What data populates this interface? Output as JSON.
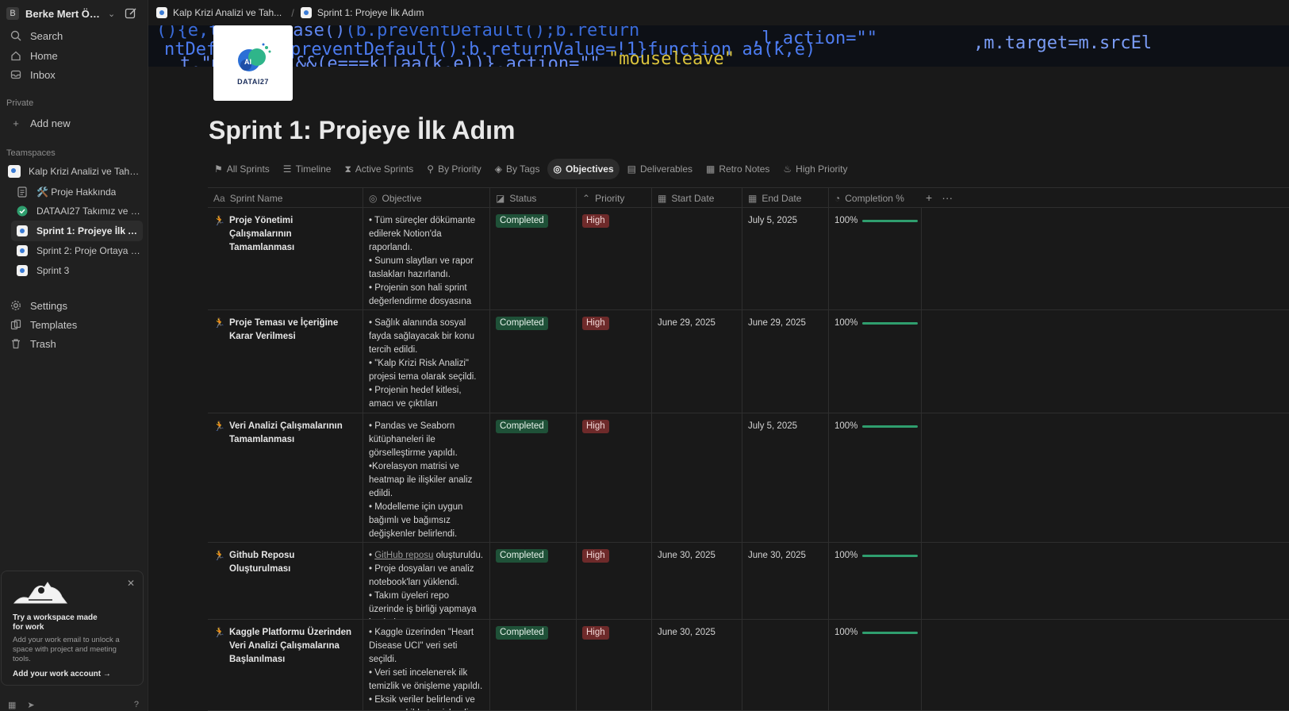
{
  "workspace": {
    "initial": "B",
    "name": "Berke Mert Öztür..."
  },
  "sidebar": {
    "top": [
      {
        "label": "Search",
        "icon": "search-icon"
      },
      {
        "label": "Home",
        "icon": "home-icon"
      },
      {
        "label": "Inbox",
        "icon": "inbox-icon"
      }
    ],
    "private_label": "Private",
    "add_new": "Add new",
    "teamspaces_label": "Teamspaces",
    "teamspace": "Kalp Krizi Analizi ve Tahmini",
    "pages": [
      {
        "label": "🛠️ Proje Hakkında",
        "icon": "document-icon"
      },
      {
        "label": "DATAAI27 Takımız ve Gör...",
        "icon": "check-circle-icon"
      },
      {
        "label": "Sprint 1: Projeye İlk Adım",
        "icon": "page-icon",
        "active": true
      },
      {
        "label": "Sprint 2: Proje Ortaya Çı...",
        "icon": "page-icon"
      },
      {
        "label": "Sprint 3",
        "icon": "page-icon"
      }
    ],
    "bottom": [
      {
        "label": "Settings",
        "icon": "gear-icon"
      },
      {
        "label": "Templates",
        "icon": "templates-icon"
      },
      {
        "label": "Trash",
        "icon": "trash-icon"
      }
    ],
    "promo": {
      "title": "Try a workspace made for work",
      "desc": "Add your work email to unlock a space with project and meeting tools.",
      "link": "Add your work account"
    }
  },
  "breadcrumb": {
    "parent": "Kalp Krizi Analizi ve Tah...",
    "current": "Sprint 1: Projeye İlk Adım"
  },
  "logo_text": "DATAI27",
  "page_title": "Sprint 1: Projeye İlk Adım",
  "tabs": [
    {
      "label": "All Sprints",
      "icon": "⚑"
    },
    {
      "label": "Timeline",
      "icon": "☰"
    },
    {
      "label": "Active Sprints",
      "icon": "⧗"
    },
    {
      "label": "By Priority",
      "icon": "⚲"
    },
    {
      "label": "By Tags",
      "icon": "◈"
    },
    {
      "label": "Objectives",
      "icon": "◎",
      "active": true
    },
    {
      "label": "Deliverables",
      "icon": "▤"
    },
    {
      "label": "Retro Notes",
      "icon": "▦"
    },
    {
      "label": "High Priority",
      "icon": "♨"
    }
  ],
  "columns": [
    {
      "label": "Sprint Name",
      "icon": "Aa"
    },
    {
      "label": "Objective",
      "icon": "◎"
    },
    {
      "label": "Status",
      "icon": "◪"
    },
    {
      "label": "Priority",
      "icon": "⌃"
    },
    {
      "label": "Start Date",
      "icon": "▦"
    },
    {
      "label": "End Date",
      "icon": "▦"
    },
    {
      "label": "Completion %",
      "icon": "◔"
    }
  ],
  "rows": [
    {
      "name": "Proje Yönetimi Çalışmalarının Tamamlanması",
      "objective": "• Tüm süreçler dökümante edilerek Notion'da raporlandı.\n• Sunum slaytları ve rapor taslakları hazırlandı.\n• Projenin son hali sprint değerlendirme dosyasına yüklendi.",
      "status": "Completed",
      "priority": "High",
      "start": "",
      "end": "July 5, 2025",
      "completion": "100%",
      "completion_value": 1.0
    },
    {
      "name": "Proje Teması ve İçeriğine Karar Verilmesi",
      "objective": "• Sağlık alanında sosyal fayda sağlayacak bir konu tercih edildi.\n• \"Kalp Krizi Risk Analizi\" projesi tema olarak seçildi.\n• Projenin hedef kitlesi, amacı ve çıktıları netleştirildi.",
      "status": "Completed",
      "priority": "High",
      "start": "June 29, 2025",
      "end": "June 29, 2025",
      "completion": "100%",
      "completion_value": 1.0
    },
    {
      "name": "Veri Analizi Çalışmalarının Tamamlanması",
      "objective": "• Pandas ve Seaborn kütüphaneleri ile görselleştirme yapıldı.\n•Korelasyon matrisi ve heatmap ile ilişkiler analiz edildi.\n• Modelleme için uygun bağımlı ve bağımsız değişkenler belirlendi.",
      "status": "Completed",
      "priority": "High",
      "start": "",
      "end": "July 5, 2025",
      "completion": "100%",
      "completion_value": 1.0
    },
    {
      "name": "Github Reposu Oluşturulması",
      "objective_link": "GitHub reposu",
      "objective": "• {link} oluşturuldu.\n• Proje dosyaları ve analiz notebook'ları yüklendi.\n• Takım üyeleri repo üzerinde iş birliği yapmaya başladı.",
      "status": "Completed",
      "priority": "High",
      "start": "June 30, 2025",
      "end": "June 30, 2025",
      "completion": "100%",
      "completion_value": 1.0
    },
    {
      "name": "Kaggle Platformu Üzerinden Veri Analizi Çalışmalarına Başlanılması",
      "objective": "• Kaggle üzerinden \"Heart Disease UCI\" veri seti seçildi.\n• Veri seti incelenerek ilk temizlik ve önişleme yapıldı.\n• Eksik veriler belirlendi ve uygun şekilde temizlendi.",
      "status": "Completed",
      "priority": "High",
      "start": "June 30, 2025",
      "end": "",
      "completion": "100%",
      "completion_value": 1.0
    }
  ]
}
